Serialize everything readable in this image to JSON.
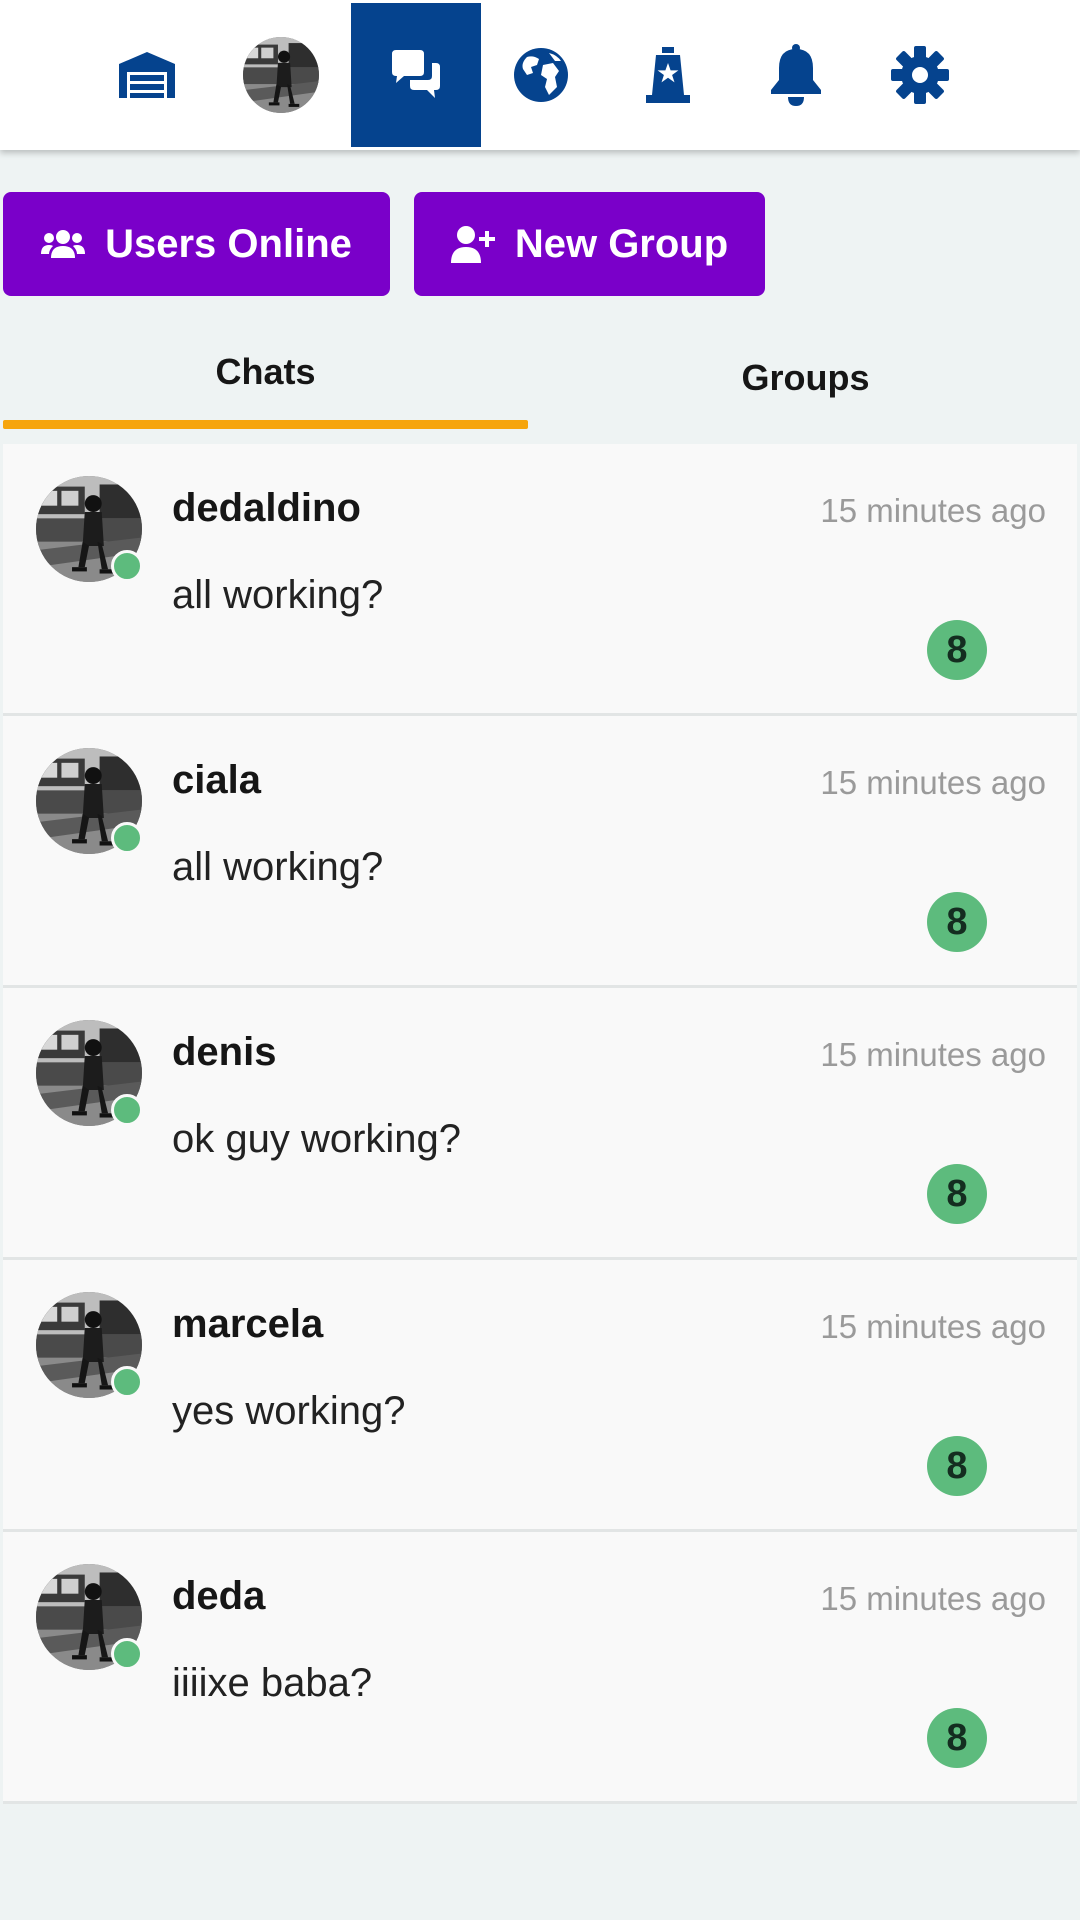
{
  "app": {
    "colors": {
      "nav_active_bg": "#05438e",
      "nav_icon": "#05438e",
      "action_button": "#7a00c9",
      "tab_underline": "#f6a50d",
      "online_status": "#5dbb7d",
      "unread_badge": "#5dbb7d"
    }
  },
  "nav": {
    "items": [
      {
        "icon": "warehouse-icon",
        "active": false
      },
      {
        "icon": "profile-avatar",
        "active": false
      },
      {
        "icon": "chat-bubbles-icon",
        "active": true
      },
      {
        "icon": "globe-icon",
        "active": false
      },
      {
        "icon": "police-badge-icon",
        "active": false
      },
      {
        "icon": "bell-icon",
        "active": false
      },
      {
        "icon": "gear-icon",
        "active": false
      }
    ]
  },
  "actions": {
    "users_online_label": "Users Online",
    "users_online_icon": "users-icon",
    "new_group_label": "New Group",
    "new_group_icon": "user-plus-icon"
  },
  "tabs": [
    {
      "label": "Chats",
      "active": true
    },
    {
      "label": "Groups",
      "active": false
    }
  ],
  "chats": [
    {
      "name": "dedaldino",
      "message": "all working?",
      "time": "15 minutes ago",
      "unread": "8",
      "online": true
    },
    {
      "name": "ciala",
      "message": "all working?",
      "time": "15 minutes ago",
      "unread": "8",
      "online": true
    },
    {
      "name": "denis",
      "message": "ok guy working?",
      "time": "15 minutes ago",
      "unread": "8",
      "online": true
    },
    {
      "name": "marcela",
      "message": "yes working?",
      "time": "15 minutes ago",
      "unread": "8",
      "online": true
    },
    {
      "name": "deda",
      "message": "iiiixe baba?",
      "time": "15 minutes ago",
      "unread": "8",
      "online": true
    }
  ]
}
